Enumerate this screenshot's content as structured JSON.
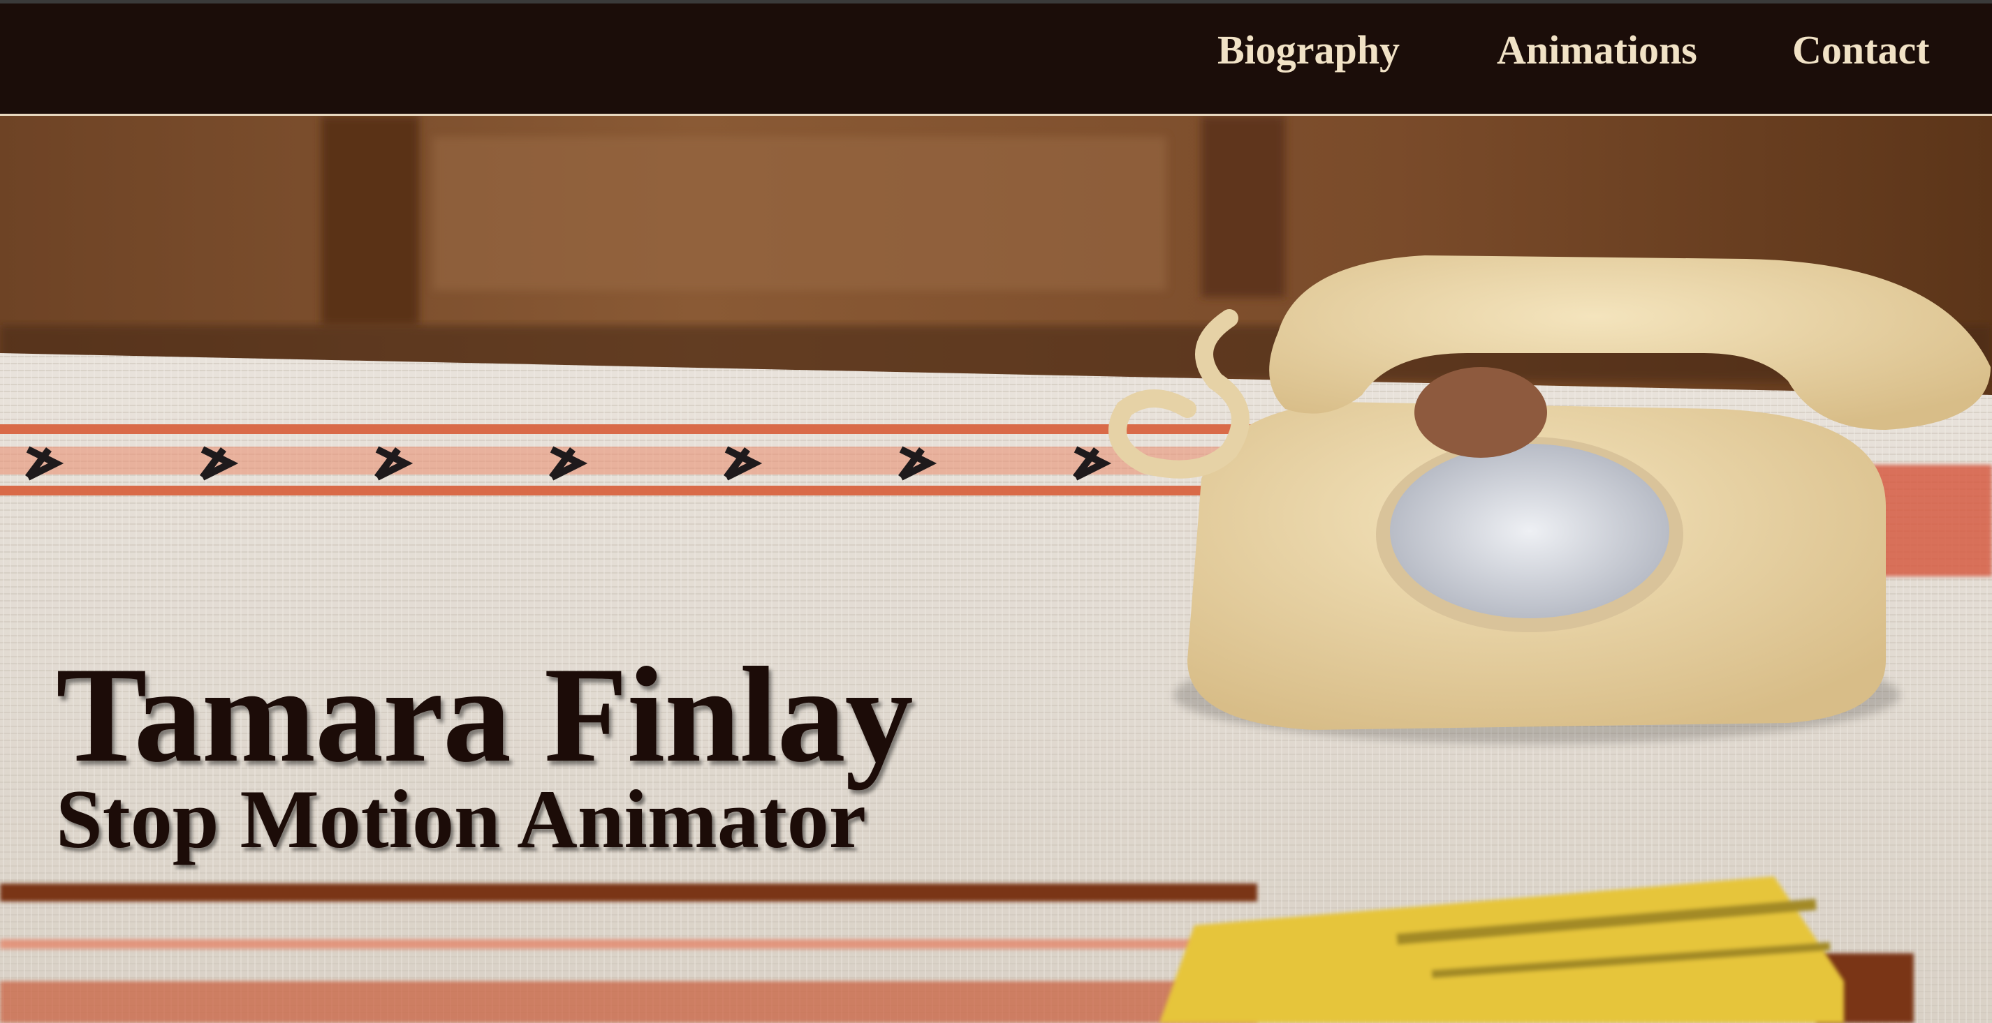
{
  "nav": {
    "items": [
      {
        "label": "Biography"
      },
      {
        "label": "Animations"
      },
      {
        "label": "Contact"
      }
    ]
  },
  "hero": {
    "title": "Tamara Finlay",
    "subtitle": "Stop Motion Animator",
    "image_subject": "clay-rotary-telephone-on-woven-rug"
  },
  "colors": {
    "nav_background": "#1b0d09",
    "nav_text": "#f1e2c6",
    "nav_border": "#e8d8c0",
    "title_text": "#1c0c08"
  }
}
